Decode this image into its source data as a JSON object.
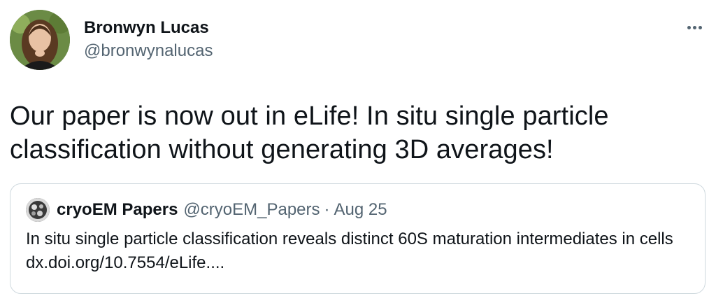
{
  "author": {
    "name": "Bronwyn Lucas",
    "handle": "@bronwynalucas"
  },
  "tweet": {
    "text": "Our paper is now out in eLife! In situ single particle classification without generating 3D averages!"
  },
  "quoted_tweet": {
    "name": "cryoEM Papers",
    "handle": "@cryoEM_Papers",
    "separator": "·",
    "date": "Aug 25",
    "text": "In situ single particle classification reveals distinct 60S maturation intermediates in cells dx.doi.org/10.7554/eLife...."
  },
  "icons": {
    "more": "more-horizontal-icon"
  },
  "colors": {
    "primary_text": "#0f1419",
    "secondary_text": "#536471",
    "border": "#cfd9de"
  }
}
